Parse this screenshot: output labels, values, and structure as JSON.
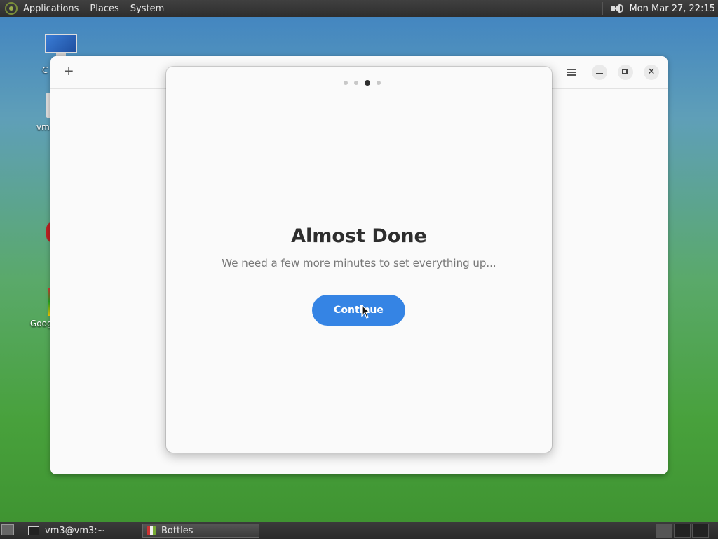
{
  "top_panel": {
    "menus": [
      "Applications",
      "Places",
      "System"
    ],
    "clock": "Mon Mar 27, 22:15"
  },
  "desktop": {
    "icon_labels": [
      "C",
      "vm",
      "Goog"
    ]
  },
  "app_window": {
    "plus_symbol": "+",
    "close_symbol": "✕"
  },
  "dialog": {
    "pager": {
      "total": 4,
      "active_index": 2
    },
    "title": "Almost Done",
    "subtitle": "We need a few more minutes to set everything up...",
    "continue_label": "Continue",
    "accent_color": "#3584e4"
  },
  "taskbar": {
    "tasks": [
      {
        "label": "vm3@vm3:~",
        "icon": "terminal-icon"
      },
      {
        "label": "Bottles",
        "icon": "bottles-icon"
      }
    ]
  }
}
